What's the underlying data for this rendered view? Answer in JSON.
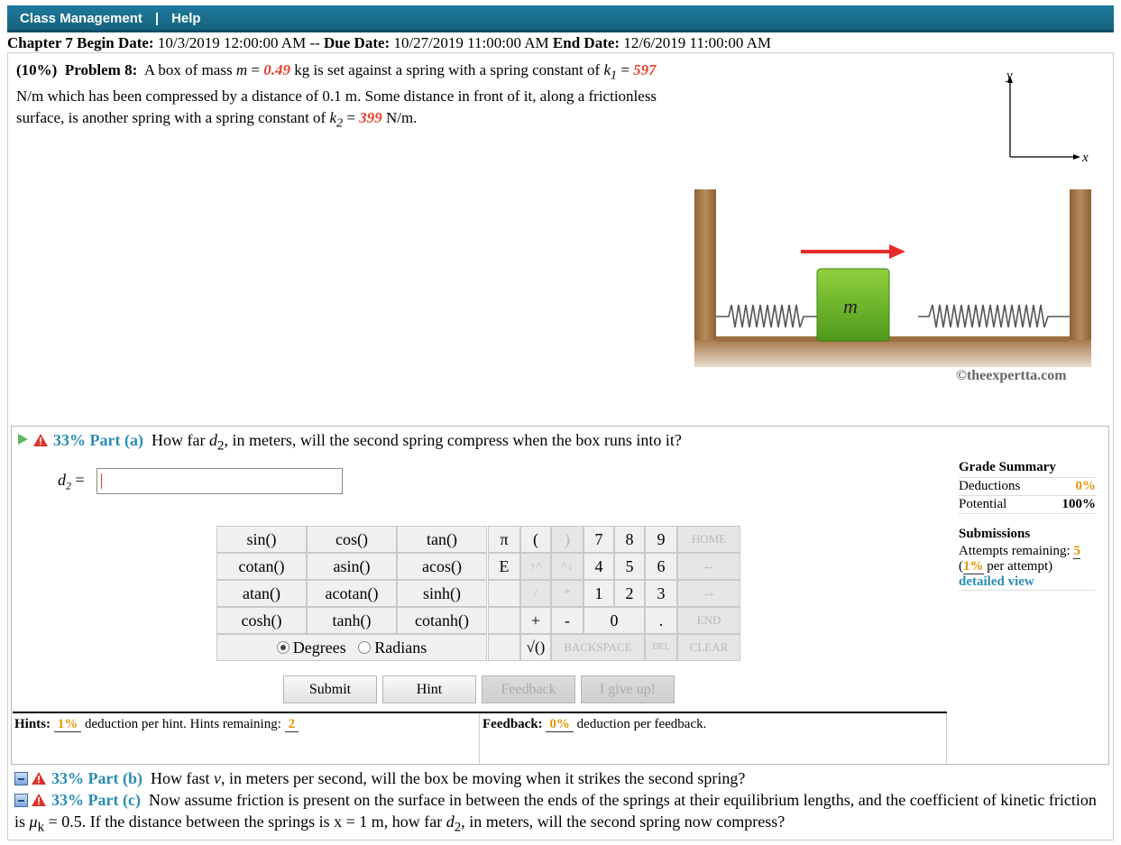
{
  "topbar": {
    "class_management": "Class Management",
    "separator": "|",
    "help": "Help"
  },
  "dates": {
    "chapter_label": "Chapter 7 Begin Date:",
    "begin": "10/3/2019 12:00:00 AM",
    "dash": "--",
    "due_label": "Due Date:",
    "due": "10/27/2019 11:00:00 AM",
    "end_label": "End Date:",
    "end": "12/6/2019 11:00:00 AM"
  },
  "problem": {
    "weight": "(10%)",
    "number": "Problem 8:",
    "text1": "A box of mass",
    "m_sym": "m",
    "eq": "=",
    "m_val": "0.49",
    "unit_kg": "kg is set against a spring with a spring constant of",
    "k1_sym": "k",
    "k1_sub": "1",
    "k1_val": "597",
    "text2": "N/m which has been compressed by a distance of 0.1 m. Some distance in front of it, along a frictionless surface, is another spring with a spring constant of",
    "k2_sym": "k",
    "k2_sub": "2",
    "k2_val": "399",
    "text3": "N/m."
  },
  "figure": {
    "axis_y": "y",
    "axis_x": "x",
    "mass_label": "m",
    "copyright": "©theexpertta.com"
  },
  "part_a": {
    "pct": "33% Part (a)",
    "q1": "How far",
    "d_sym": "d",
    "d_sub": "2",
    "q2": ", in meters, will the second spring compress when the box runs into it?",
    "ans_eq": "=",
    "ans_value": ""
  },
  "calculator": {
    "functions": [
      "sin()",
      "cos()",
      "tan()",
      "cotan()",
      "asin()",
      "acos()",
      "atan()",
      "acotan()",
      "sinh()",
      "cosh()",
      "tanh()",
      "cotanh()"
    ],
    "degrees": "Degrees",
    "radians": "Radians",
    "pi": "π",
    "lparen": "(",
    "rparen": ")",
    "e": "E",
    "up": "↑^",
    "down": "^↓",
    "slash": "/",
    "star": "*",
    "plus": "+",
    "minus": "-",
    "sqrt": "√()",
    "digits": [
      "7",
      "8",
      "9",
      "4",
      "5",
      "6",
      "1",
      "2",
      "3",
      "0",
      "."
    ],
    "home": "HOME",
    "left": "←",
    "right": "→",
    "end": "END",
    "backspace": "BACKSPACE",
    "del": "DEL",
    "clear": "CLEAR"
  },
  "actions": {
    "submit": "Submit",
    "hint": "Hint",
    "feedback": "Feedback",
    "give_up": "I give up!"
  },
  "hints": {
    "label": "Hints:",
    "pct": "1%",
    "text": "deduction per hint. Hints remaining:",
    "remaining": "2"
  },
  "feedback": {
    "label": "Feedback:",
    "pct": "0%",
    "text": "deduction per feedback."
  },
  "grade": {
    "title": "Grade Summary",
    "deductions": "Deductions",
    "deductions_val": "0%",
    "potential": "Potential",
    "potential_val": "100%",
    "submissions": "Submissions",
    "attempts": "Attempts remaining:",
    "attempts_val": "5",
    "per_open": "(",
    "per_pct": "1%",
    "per_text": "per attempt)",
    "detailed": "detailed view"
  },
  "part_b": {
    "pct": "33% Part (b)",
    "text": "How fast",
    "v_sym": "v",
    "text2": ", in meters per second, will the box be moving when it strikes the second spring?"
  },
  "part_c": {
    "pct": "33% Part (c)",
    "text": "Now assume friction is present on the surface in between the ends of the springs at their equilibrium lengths, and the coefficient of kinetic friction is",
    "mu_sym": "μ",
    "mu_sub": "k",
    "text2": "= 0.5. If the distance between the springs is x = 1 m, how far",
    "d_sym": "d",
    "d_sub": "2",
    "text3": ", in meters, will the second spring now compress?"
  },
  "colors": {
    "topbar": "#16637f",
    "given_value": "#e8432b",
    "part_label": "#2a8db5",
    "accent_orange": "#e69500",
    "box_green": "#6cb52d",
    "wall_brown": "#a87b4f",
    "arrow_red": "#e82a2a"
  }
}
